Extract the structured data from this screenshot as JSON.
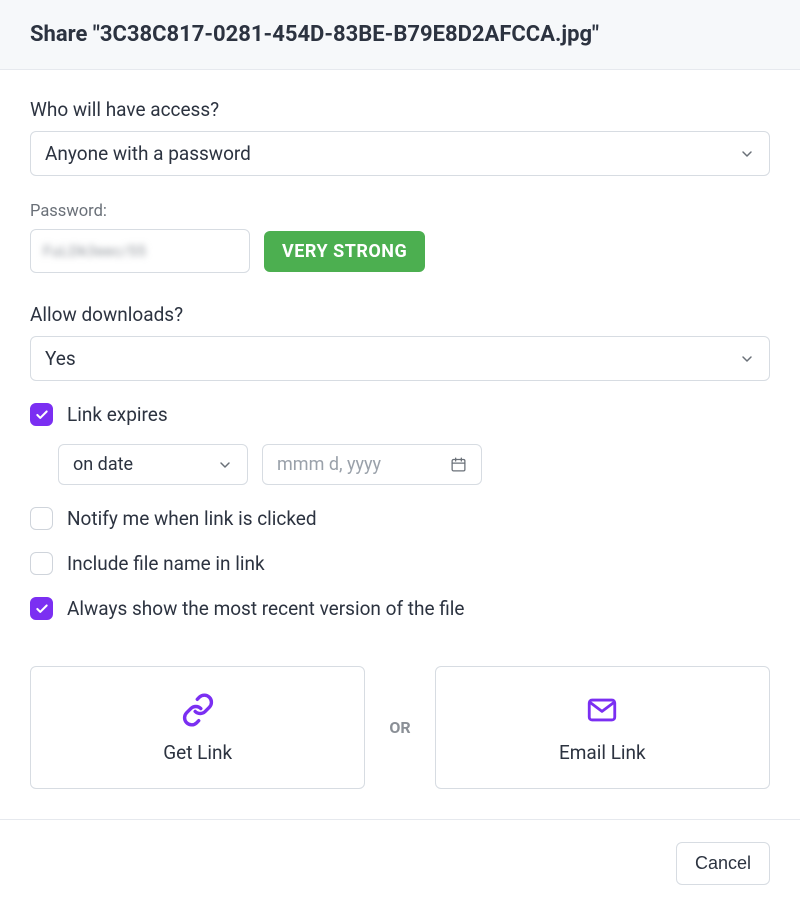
{
  "header": {
    "title": "Share \"3C38C817-0281-454D-83BE-B79E8D2AFCCA.jpg\""
  },
  "access": {
    "label": "Who will have access?",
    "value": "Anyone with a password"
  },
  "password": {
    "label": "Password:",
    "masked_value": "FuLDk3eec/55",
    "strength": "VERY STRONG"
  },
  "downloads": {
    "label": "Allow downloads?",
    "value": "Yes"
  },
  "link_expires": {
    "label": "Link expires",
    "checked": true,
    "mode_value": "on date",
    "date_placeholder": "mmm d, yyyy"
  },
  "notify_click": {
    "label": "Notify me when link is clicked",
    "checked": false
  },
  "include_filename": {
    "label": "Include file name in link",
    "checked": false
  },
  "always_recent": {
    "label": "Always show the most recent version of the file",
    "checked": true
  },
  "actions": {
    "get_link": "Get Link",
    "or": "OR",
    "email_link": "Email Link"
  },
  "footer": {
    "cancel": "Cancel"
  },
  "colors": {
    "accent": "#7b2ff2",
    "success": "#4caf50"
  }
}
